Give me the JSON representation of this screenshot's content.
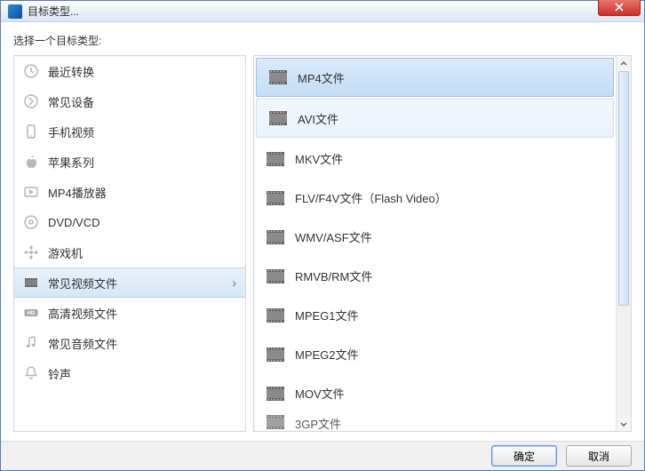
{
  "window": {
    "title": "目标类型..."
  },
  "instruction": "选择一个目标类型:",
  "categories": [
    {
      "icon": "clock",
      "label": "最近转换"
    },
    {
      "icon": "arrow-right",
      "label": "常见设备"
    },
    {
      "icon": "phone",
      "label": "手机视频"
    },
    {
      "icon": "apple",
      "label": "苹果系列"
    },
    {
      "icon": "player",
      "label": "MP4播放器"
    },
    {
      "icon": "disc",
      "label": "DVD/VCD"
    },
    {
      "icon": "gamepad",
      "label": "游戏机"
    },
    {
      "icon": "film",
      "label": "常见视频文件",
      "selected": true
    },
    {
      "icon": "hd",
      "label": "高清视频文件"
    },
    {
      "icon": "music",
      "label": "常见音频文件"
    },
    {
      "icon": "bell",
      "label": "铃声"
    }
  ],
  "formats": [
    {
      "label": "MP4文件",
      "selected": true
    },
    {
      "label": "AVI文件",
      "hover": true
    },
    {
      "label": "MKV文件"
    },
    {
      "label": "FLV/F4V文件（Flash Video）"
    },
    {
      "label": "WMV/ASF文件"
    },
    {
      "label": "RMVB/RM文件"
    },
    {
      "label": "MPEG1文件"
    },
    {
      "label": "MPEG2文件"
    },
    {
      "label": "MOV文件"
    },
    {
      "label": "3GP文件",
      "partial": true
    }
  ],
  "buttons": {
    "ok": "确定",
    "cancel": "取消"
  }
}
